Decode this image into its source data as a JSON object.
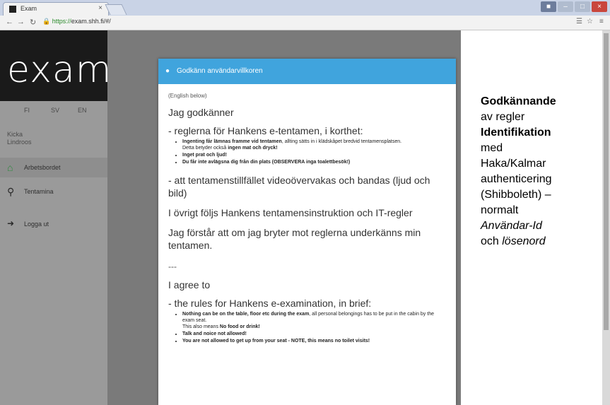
{
  "browser": {
    "tab_title": "Exam",
    "tab_close": "×",
    "url": "https://exam.shh.fi/#/",
    "url_https": "https://",
    "url_rest": "exam.shh.fi/#/"
  },
  "sidebar": {
    "logo": "exam",
    "languages": [
      "FI",
      "SV",
      "EN"
    ],
    "user_first": "Kicka",
    "user_last": "Lindroos",
    "menu": [
      {
        "label": "Arbetsbordet",
        "icon": "home-icon"
      },
      {
        "label": "Tentamina",
        "icon": "search-icon"
      },
      {
        "label": "Logga ut",
        "icon": "logout-icon"
      }
    ]
  },
  "modal": {
    "title": "Godkänn användarvillkoren",
    "english_below": "(English below)",
    "sv_heading": "Jag godkänner",
    "sv_rules_heading": "- reglerna för Hankens e-tentamen, i korthet:",
    "sv_rule1_bold": "Ingenting får lämnas framme vid tentamen",
    "sv_rule1_rest": ", allting sätts in i klädskåpet bredvid tentamensplatsen.",
    "sv_rule1_line2_pre": "Detta betyder också ",
    "sv_rule1_line2_bold": "ingen mat och dryck!",
    "sv_rule2": "Inget prat och ljud!",
    "sv_rule3": "Du får inte avlägsna dig från din plats (OBSERVERA inga toalettbesök!)",
    "sv_video": "- att tentamenstillfället videoövervakas och bandas (ljud och bild)",
    "sv_other": "I övrigt följs Hankens tentamensinstruktion och IT-regler",
    "sv_fail": "Jag förstår att om jag bryter mot reglerna underkänns min tentamen.",
    "separator": "---",
    "en_heading": "I agree to",
    "en_rules_heading": "- the rules for Hankens e-examination, in brief:",
    "en_rule1_bold": "Nothing can be on the table, floor etc during the exam",
    "en_rule1_rest": ", all personal belongings has to be put in the cabin by the exam seat.",
    "en_rule1_line2_pre": "This also means ",
    "en_rule1_line2_bold": "No food or drink!",
    "en_rule2": "Talk and noice not allowed!",
    "en_rule3": "You are not allowed to get up from your seat - NOTE, this means no toilet visits!"
  },
  "annotation": {
    "line1": "Godkännande",
    "line2": "av regler",
    "line3": "Identifikation",
    "line4": "med",
    "line5": "Haka/Kalmar",
    "line6": "authenticering",
    "line7": "(Shibboleth) –",
    "line8": "normalt",
    "line9": "Användar-Id",
    "line10_pre": "och ",
    "line10_ital": "lösenord"
  },
  "colors": {
    "modal_header": "#40a4dd",
    "sidebar": "#9a9a9a",
    "logo_bg": "#1a1a1a"
  }
}
